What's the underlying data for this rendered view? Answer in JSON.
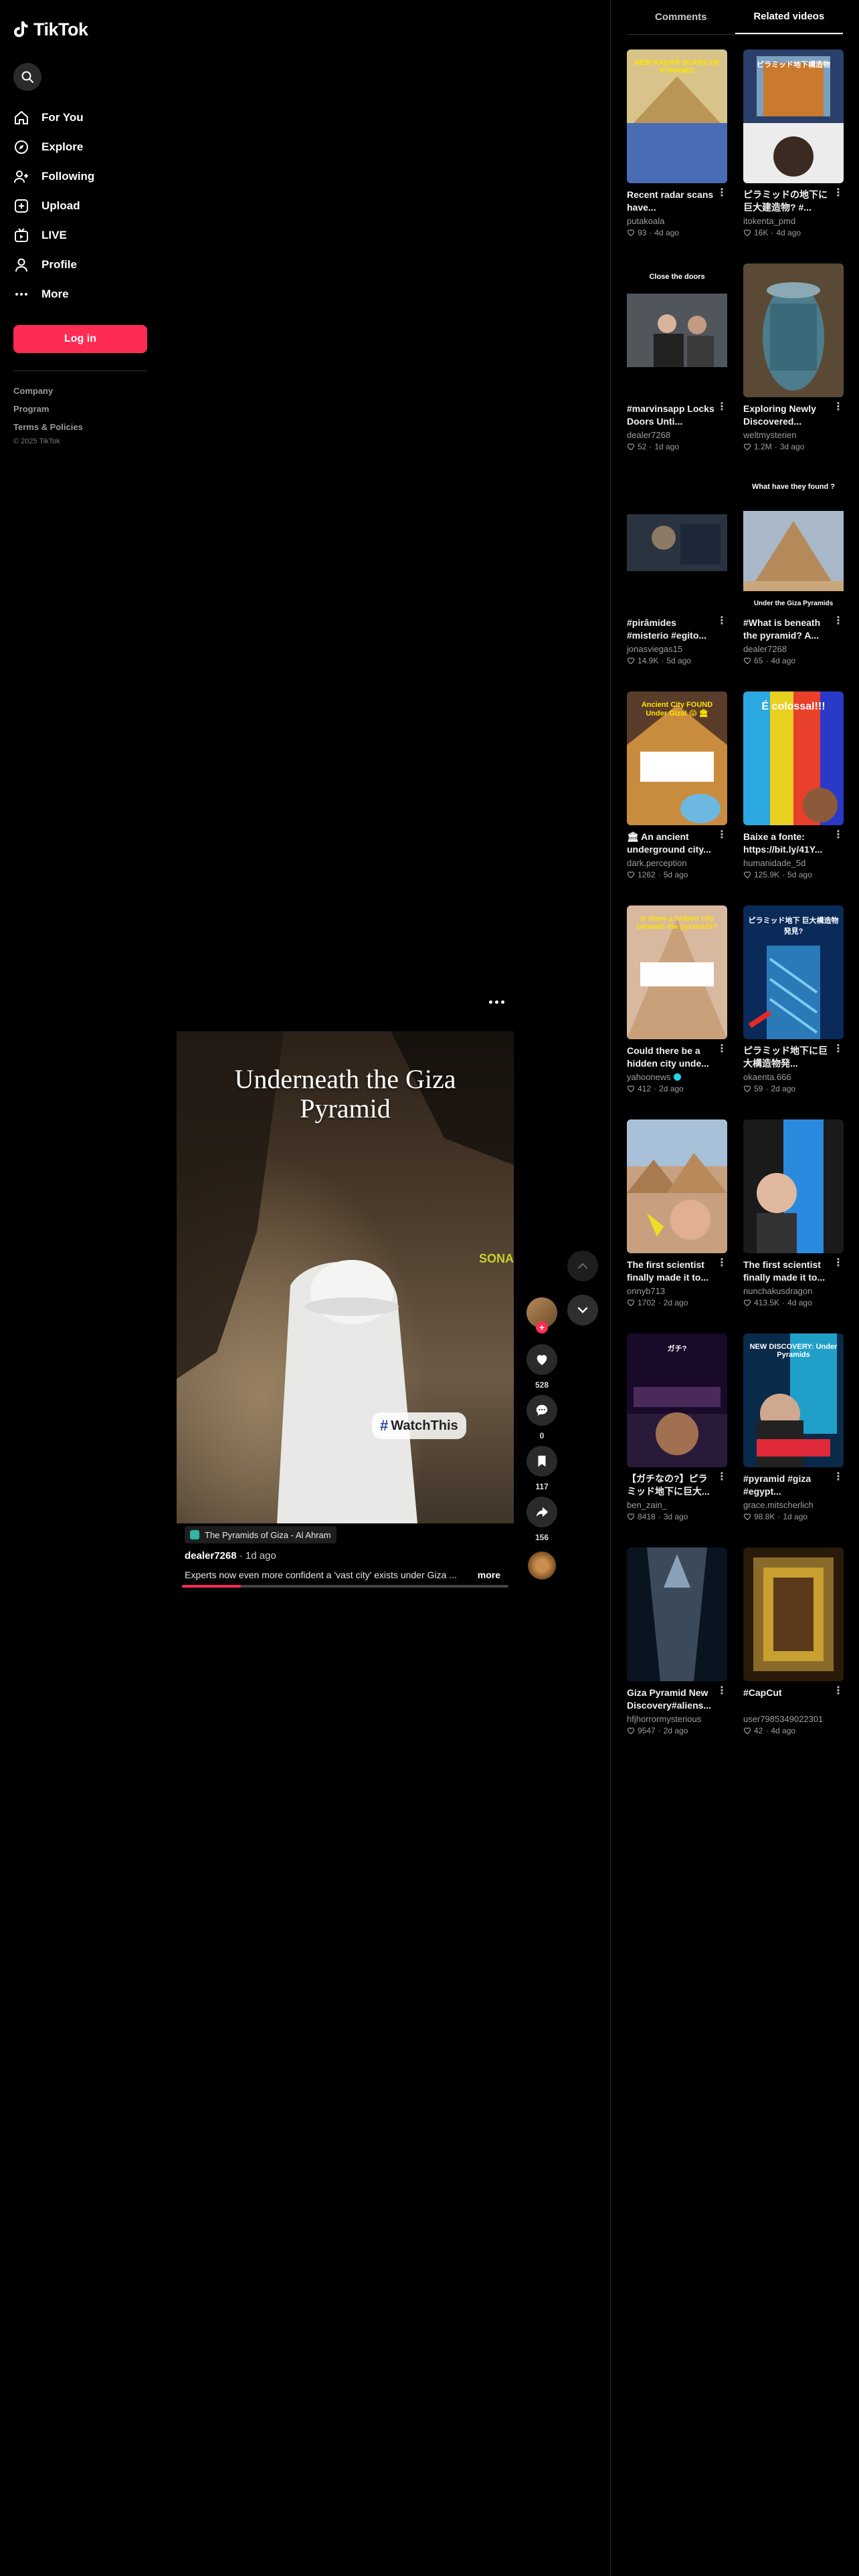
{
  "app": {
    "name": "TikTok"
  },
  "sidebar": {
    "items": [
      {
        "label": "For You",
        "icon": "home-icon"
      },
      {
        "label": "Explore",
        "icon": "compass-icon"
      },
      {
        "label": "Following",
        "icon": "user-plus-icon"
      },
      {
        "label": "Upload",
        "icon": "upload-icon"
      },
      {
        "label": "LIVE",
        "icon": "live-icon"
      },
      {
        "label": "Profile",
        "icon": "profile-icon"
      },
      {
        "label": "More",
        "icon": "more-icon"
      }
    ],
    "login_label": "Log in",
    "footer": [
      "Company",
      "Program",
      "Terms & Policies"
    ],
    "copyright": "© 2025 TikTok"
  },
  "video": {
    "overlay_title": "Underneath the Giza Pyramid",
    "sticker_hash": "#",
    "sticker_text": "WatchThis",
    "side_text": "SONA",
    "music": "The Pyramids of Giza - Al Ahram",
    "author": "dealer7268",
    "age": "1d ago",
    "description": "Experts now even more confident a 'vast city' exists under Giza ...",
    "more_label": "more",
    "progress": 0.18,
    "likes": "528",
    "comments": "0",
    "saves": "117",
    "shares": "156",
    "follow_plus": "+"
  },
  "panel": {
    "tabs": [
      "Comments",
      "Related videos"
    ],
    "active_tab": 1,
    "videos": [
      {
        "title": "Recent radar scans have...",
        "author": "putakoala",
        "likes": "93",
        "age": "4d ago",
        "verified": false,
        "thumb": "t1",
        "thumb_text": "NEW RADAR SCANS OF PYRAMID"
      },
      {
        "title": "ピラミッドの地下に巨大建造物? #...",
        "author": "itokenta_pmd",
        "likes": "16K",
        "age": "4d ago",
        "verified": false,
        "thumb": "t2",
        "thumb_text": "ピラミッド地下構造物"
      },
      {
        "title": "#marvinsapp Locks Doors Unti...",
        "author": "dealer7268",
        "likes": "52",
        "age": "1d ago",
        "verified": false,
        "thumb": "t3",
        "thumb_text": "Close the doors"
      },
      {
        "title": "Exploring Newly Discovered...",
        "author": "weltmysterien",
        "likes": "1.2M",
        "age": "3d ago",
        "verified": false,
        "thumb": "t4",
        "thumb_text": ""
      },
      {
        "title": "#pirâmides #misterio #egito...",
        "author": "jonasviegas15",
        "likes": "14.9K",
        "age": "5d ago",
        "verified": false,
        "thumb": "t5",
        "thumb_text": ""
      },
      {
        "title": "#What is beneath the pyramid? A...",
        "author": "dealer7268",
        "likes": "65",
        "age": "4d ago",
        "verified": false,
        "thumb": "t6",
        "thumb_text": "What have they found ?",
        "thumb_text2": "Under the Giza Pyramids"
      },
      {
        "title": "🏛 An ancient underground city...",
        "author": "dark.perception",
        "likes": "1262",
        "age": "5d ago",
        "verified": false,
        "thumb": "t7",
        "thumb_text": "Ancient City FOUND Under Giza! 😱 🏛"
      },
      {
        "title": "Baixe a fonte: https://bit.ly/41Y...",
        "author": "humanidade_5d",
        "likes": "125.9K",
        "age": "5d ago",
        "verified": false,
        "thumb": "t8",
        "thumb_text": "É colossal!!!"
      },
      {
        "title": "Could there be a hidden city unde...",
        "author": "yahoonews",
        "likes": "412",
        "age": "2d ago",
        "verified": true,
        "thumb": "t9",
        "thumb_text": "Is there a hidden city beneath the pyramids?"
      },
      {
        "title": "ピラミッド地下に巨大構造物発...",
        "author": "okaenta.666",
        "likes": "59",
        "age": "2d ago",
        "verified": false,
        "thumb": "t10",
        "thumb_text": "ピラミッド地下 巨大構造物発見?"
      },
      {
        "title": "The first scientist finally made it to...",
        "author": "onnyb713",
        "likes": "1702",
        "age": "2d ago",
        "verified": false,
        "thumb": "t11",
        "thumb_text": ""
      },
      {
        "title": "The first scientist finally made it to...",
        "author": "nunchakusdragon",
        "likes": "413.5K",
        "age": "4d ago",
        "verified": false,
        "thumb": "t12",
        "thumb_text": ""
      },
      {
        "title": "【ガチなの?】ピラミッド地下に巨大...",
        "author": "ben_zain_",
        "likes": "8418",
        "age": "3d ago",
        "verified": false,
        "thumb": "t13",
        "thumb_text": "ガチ?"
      },
      {
        "title": "#pyramid #giza #egypt...",
        "author": "grace.mitscherlich",
        "likes": "98.8K",
        "age": "1d ago",
        "verified": false,
        "thumb": "t14",
        "thumb_text": "NEW DISCOVERY: Under Pyramids"
      },
      {
        "title": "Giza Pyramid New Discovery#aliens...",
        "author": "hfjhorrormysterious",
        "likes": "9547",
        "age": "2d ago",
        "verified": false,
        "thumb": "t15",
        "thumb_text": ""
      },
      {
        "title": "#CapCut",
        "author": "user7985349022301",
        "likes": "42",
        "age": "4d ago",
        "verified": false,
        "thumb": "t16",
        "thumb_text": ""
      }
    ]
  }
}
